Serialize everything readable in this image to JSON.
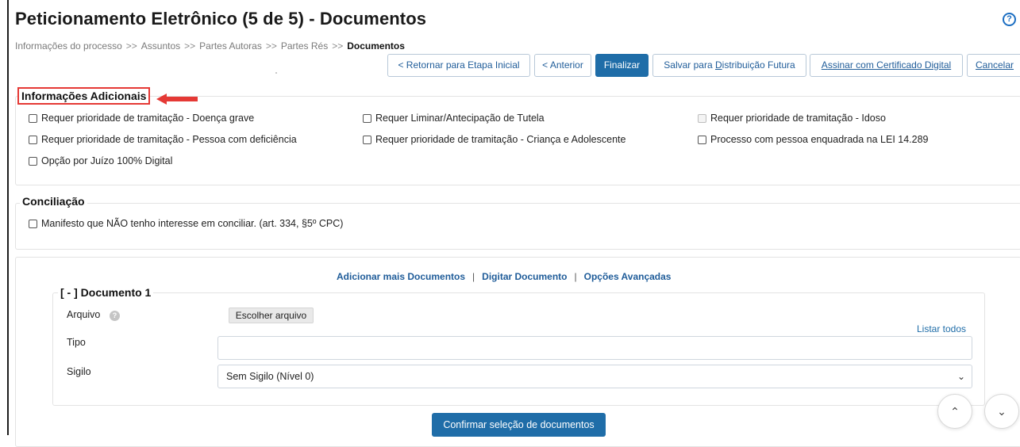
{
  "page": {
    "title": "Peticionamento Eletrônico (5 de 5) - Documentos",
    "help_icon": "?"
  },
  "breadcrumb": {
    "items": [
      "Informações do processo",
      "Assuntos",
      "Partes Autoras",
      "Partes Rés"
    ],
    "separator": ">>",
    "current": "Documentos"
  },
  "toolbar": {
    "back_initial": "< Retornar para Etapa Inicial",
    "previous": "< Anterior",
    "finish": "Finalizar",
    "save_prefix": "Salvar para ",
    "save_underlined": "D",
    "save_suffix": "istribuição Futura",
    "sign_underlined": "A",
    "sign_suffix": "ssinar com Certificado Digital",
    "cancel_underlined": "C",
    "cancel_suffix": "ancelar"
  },
  "additional": {
    "title": "Informações Adicionais",
    "options": [
      "Requer prioridade de tramitação - Doença grave",
      "Requer Liminar/Antecipação de Tutela",
      "Requer prioridade de tramitação - Idoso",
      "Requer prioridade de tramitação - Pessoa com deficiência",
      "Requer prioridade de tramitação - Criança e Adolescente",
      "Processo com pessoa enquadrada na LEI 14.289",
      "Opção por Juízo 100% Digital"
    ]
  },
  "conciliation": {
    "title": "Conciliação",
    "option": "Manifesto que NÃO tenho interesse em conciliar. (art. 334, §5º CPC)"
  },
  "documents": {
    "links": [
      "Adicionar mais Documentos",
      "Digitar Documento",
      "Opções Avançadas"
    ],
    "separator": "|",
    "doc_title": "[ - ] Documento 1",
    "file_label": "Arquivo",
    "help_glyph": "?",
    "choose_file": "Escolher arquivo",
    "list_all": "Listar todos",
    "type_label": "Tipo",
    "type_value": "",
    "secrecy_label": "Sigilo",
    "secrecy_value": "Sem Sigilo (Nível 0)",
    "confirm": "Confirmar seleção de documentos"
  },
  "scroll": {
    "up": "⌃",
    "down": "⌄"
  },
  "colors": {
    "accent": "#1f6da8",
    "link": "#1f5c99",
    "highlight_red": "#e53935"
  }
}
